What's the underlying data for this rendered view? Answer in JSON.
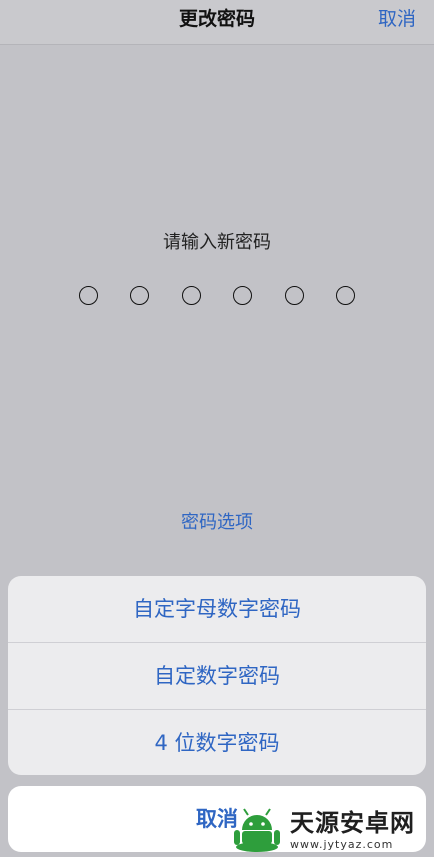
{
  "nav": {
    "title": "更改密码",
    "cancel_label": "取消"
  },
  "passcode": {
    "prompt": "请输入新密码",
    "digit_count": 6,
    "entered_count": 0,
    "options_label": "密码选项"
  },
  "action_sheet": {
    "items": [
      {
        "label": "自定字母数字密码"
      },
      {
        "label": "自定数字密码"
      },
      {
        "label": "4 位数字密码"
      }
    ],
    "cancel_label": "取消"
  },
  "watermark": {
    "name": "天源安卓网",
    "url": "www.jytyaz.com"
  },
  "colors": {
    "accent": "#2f66c3",
    "background": "#c2c2c7",
    "logo_green": "#2e9e3c"
  }
}
